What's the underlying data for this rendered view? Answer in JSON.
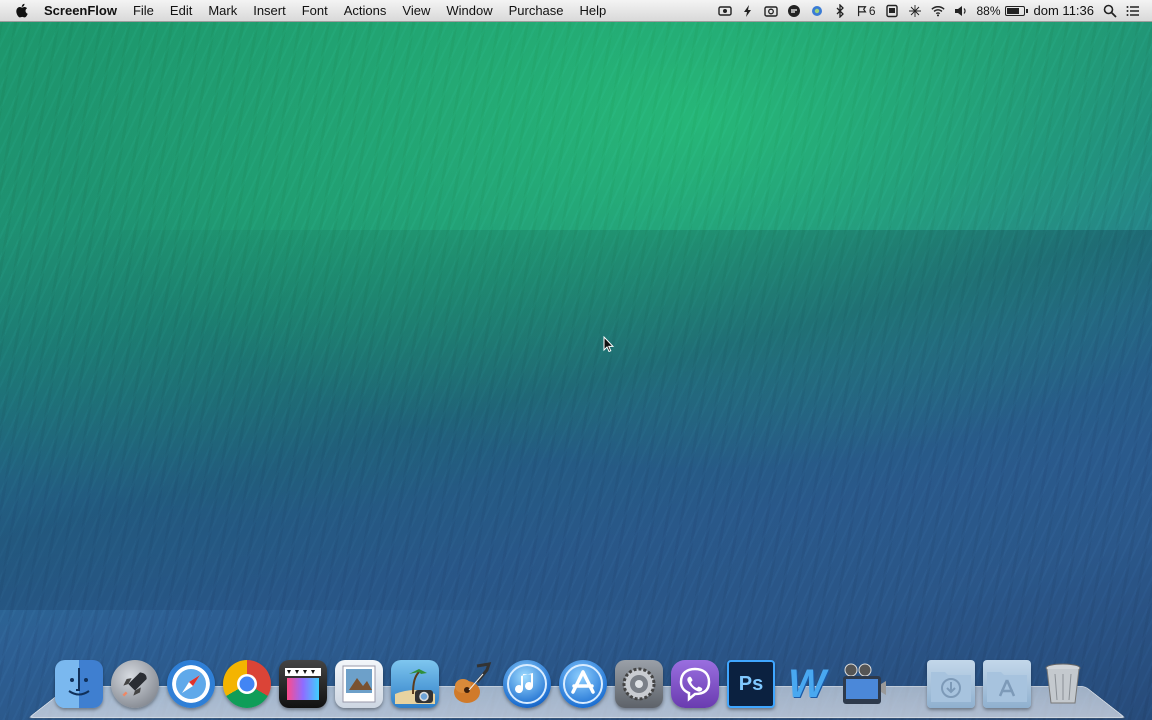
{
  "menubar": {
    "app_name": "ScreenFlow",
    "menus": [
      "File",
      "Edit",
      "Mark",
      "Insert",
      "Font",
      "Actions",
      "View",
      "Window",
      "Purchase",
      "Help"
    ],
    "status": {
      "icons": [
        "screenflow-record-icon",
        "bolt-icon",
        "camera-icon",
        "chat-icon",
        "sync-icon",
        "bluetooth-icon",
        "flag-icon",
        "display-icon",
        "wifi-icon",
        "volume-icon",
        "battery-icon",
        "spotlight-icon",
        "list-icon"
      ],
      "notification_count": "6",
      "battery_percent": "88%",
      "battery_level": 0.88,
      "clock": "dom 11:36"
    }
  },
  "dock": {
    "apps": [
      {
        "name": "finder-icon",
        "color": "#4a90d9"
      },
      {
        "name": "launchpad-icon",
        "color": "#8a8f99"
      },
      {
        "name": "safari-icon",
        "color": "#2f7fd6"
      },
      {
        "name": "chrome-icon",
        "color": "#dd4b39"
      },
      {
        "name": "final-cut-icon",
        "color": "#222222"
      },
      {
        "name": "preview-icon",
        "color": "#e6ecf4"
      },
      {
        "name": "iphoto-icon",
        "color": "#3a8ad6"
      },
      {
        "name": "garageband-icon",
        "color": "#c8702a"
      },
      {
        "name": "itunes-icon",
        "color": "#2b7be0"
      },
      {
        "name": "app-store-icon",
        "color": "#2f86e0"
      },
      {
        "name": "system-preferences-icon",
        "color": "#7a7f86"
      },
      {
        "name": "viber-icon",
        "color": "#7d4fbf"
      },
      {
        "name": "photoshop-icon",
        "color": "#0b2a4a"
      },
      {
        "name": "word-icon",
        "color": "#3b6fc4"
      },
      {
        "name": "imovie-icon",
        "color": "#5a6a80"
      }
    ],
    "photoshop_label": "Ps",
    "word_label": "W",
    "right_items": [
      {
        "name": "downloads-folder-icon",
        "color": "#a9c3dc"
      },
      {
        "name": "applications-folder-icon",
        "color": "#a9c3dc"
      },
      {
        "name": "trash-icon",
        "color": "#bfc4c9"
      }
    ]
  }
}
